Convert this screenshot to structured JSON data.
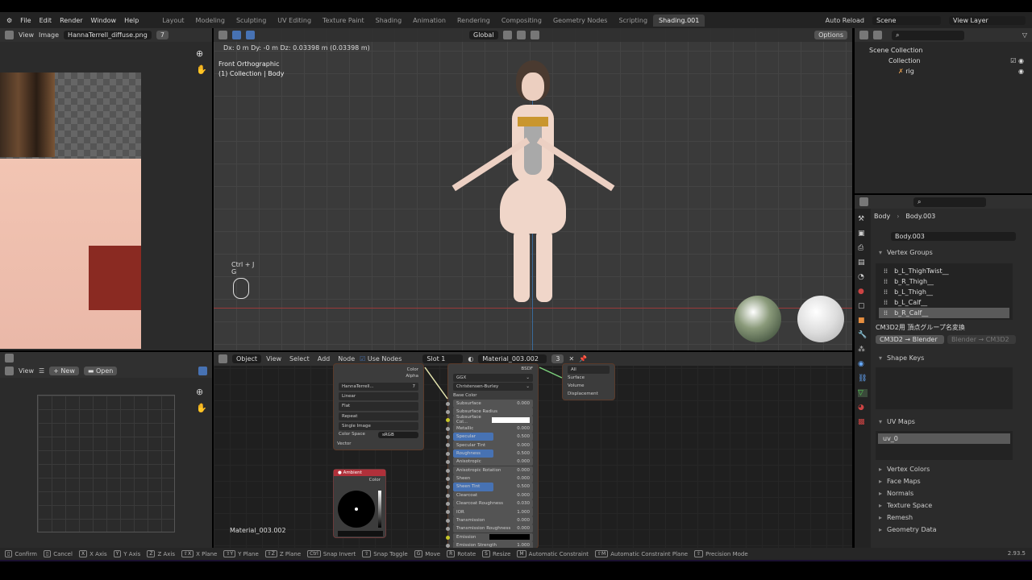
{
  "menu": [
    "File",
    "Edit",
    "Render",
    "Window",
    "Help"
  ],
  "workspaces": [
    "Layout",
    "Modeling",
    "Sculpting",
    "UV Editing",
    "Texture Paint",
    "Shading",
    "Animation",
    "Rendering",
    "Compositing",
    "Geometry Nodes",
    "Scripting",
    "Shading.001"
  ],
  "active_workspace": "Shading.001",
  "topright": {
    "auto_reload": "Auto Reload",
    "scene": "Scene",
    "view_layer": "View Layer"
  },
  "image_editor": {
    "view": "View",
    "image": "Image",
    "image_name": "HannaTerrell_diffuse.png",
    "users": "7"
  },
  "viewport": {
    "transform_info": "Dx: 0 m  Dy: -0 m  Dz: 0.03398 m (0.03398 m)",
    "view_name": "Front Orthographic",
    "collection_info": "(1) Collection | Body",
    "orientation": "Global",
    "options": "Options",
    "shortcut_hint": "Ctrl + J",
    "shortcut_hint2": "G"
  },
  "outliner": {
    "scene_collection": "Scene Collection",
    "collection": "Collection",
    "rig": "rig"
  },
  "bottom_left": {
    "view": "View",
    "new": "New",
    "open": "Open"
  },
  "node_editor": {
    "mode": "Object",
    "menus": [
      "View",
      "Select",
      "Add",
      "Node"
    ],
    "use_nodes": "Use Nodes",
    "slot": "Slot 1",
    "material": "Material_003.002",
    "users": "3",
    "material_label": "Material_003.002"
  },
  "image_node": {
    "outputs": [
      "Color",
      "Alpha"
    ],
    "image": "HannaTerrell...",
    "users": "7",
    "dropdowns": [
      "Linear",
      "Flat",
      "Repeat",
      "Single Image"
    ],
    "color_space_label": "Color Space",
    "color_space": "sRGB",
    "input": "Vector"
  },
  "bsdf_node": {
    "output": "BSDF",
    "distribution": "GGX",
    "subsurface_method": "Christensen-Burley",
    "base_color": "Base Color",
    "rows": [
      [
        "Subsurface",
        "0.000"
      ],
      [
        "Subsurface Radius",
        ""
      ],
      [
        "Subsurface Col...",
        ""
      ],
      [
        "Metallic",
        "0.000"
      ],
      [
        "Specular",
        "0.500"
      ],
      [
        "Specular Tint",
        "0.000"
      ],
      [
        "Roughness",
        "0.500"
      ],
      [
        "Anisotropic",
        "0.000"
      ],
      [
        "Anisotropic Rotation",
        "0.000"
      ],
      [
        "Sheen",
        "0.000"
      ],
      [
        "Sheen Tint",
        "0.500"
      ],
      [
        "Clearcoat",
        "0.000"
      ],
      [
        "Clearcoat Roughness",
        "0.030"
      ],
      [
        "IOR",
        "1.000"
      ],
      [
        "Transmission",
        "0.000"
      ],
      [
        "Transmission Roughness",
        "0.000"
      ],
      [
        "Emission",
        ""
      ],
      [
        "Emission Strength",
        "1.000"
      ]
    ]
  },
  "output_node": {
    "target": "All",
    "inputs": [
      "Surface",
      "Volume",
      "Displacement"
    ]
  },
  "ambient_node": {
    "title": "Ambient",
    "output": "Color"
  },
  "properties": {
    "object": "Body",
    "mesh": "Body.003",
    "mesh_field": "Body.003",
    "vertex_groups_title": "Vertex Groups",
    "vertex_groups": [
      "b_L_ThighTwist__",
      "b_R_Thigh__",
      "b_L_Thigh__",
      "b_L_Calf__",
      "b_R_Calf__"
    ],
    "addon_title": "CM3D2用 頂点グループ名変換",
    "cm3d2_to_blender": "CM3D2 → Blender",
    "blender_to_cm3d2": "Blender → CM3D2",
    "shape_keys": "Shape Keys",
    "uv_maps": "UV Maps",
    "uv_name": "uv_0",
    "sections": [
      "Vertex Colors",
      "Face Maps",
      "Normals",
      "Texture Space",
      "Remesh",
      "Geometry Data"
    ]
  },
  "status": [
    [
      "mouse-left",
      "Confirm"
    ],
    [
      "mouse-right",
      "Cancel"
    ],
    [
      "X",
      "X Axis"
    ],
    [
      "Y",
      "Y Axis"
    ],
    [
      "Z",
      "Z Axis"
    ],
    [
      "⇧X",
      "X Plane"
    ],
    [
      "⇧Y",
      "Y Plane"
    ],
    [
      "⇧Z",
      "Z Plane"
    ],
    [
      "Ctrl",
      "Snap Invert"
    ],
    [
      "⇧",
      "Snap Toggle"
    ],
    [
      "G",
      "Move"
    ],
    [
      "R",
      "Rotate"
    ],
    [
      "S",
      "Resize"
    ],
    [
      "M",
      "Automatic Constraint"
    ],
    [
      "⇧M",
      "Automatic Constraint Plane"
    ],
    [
      "⇧",
      "Precision Mode"
    ]
  ],
  "version": "2.93.5",
  "colors": {
    "accent": "#4772b3",
    "selection": "#5a5a5a",
    "node_header_red": "#b0303a"
  }
}
